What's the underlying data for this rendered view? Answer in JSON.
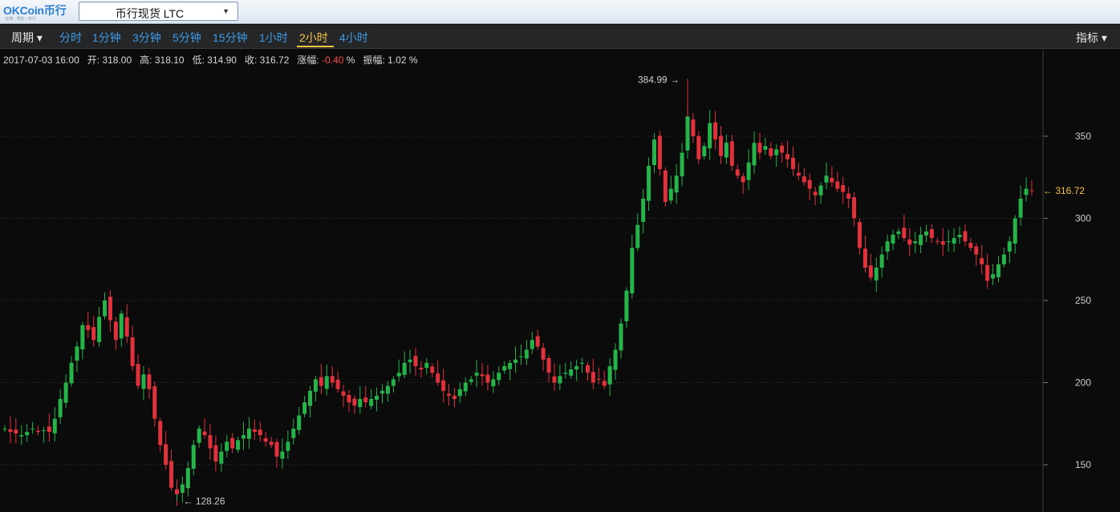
{
  "app": {
    "logo_text": "OKCoin币行",
    "logo_subtext": "全球 · 领先 · 币行"
  },
  "symbol_select": {
    "label": "币行现货 LTC",
    "caret": "▼"
  },
  "toolbar": {
    "period_menu": "周期 ▾",
    "periods": [
      "分时",
      "1分钟",
      "3分钟",
      "5分钟",
      "15分钟",
      "1小时",
      "2小时",
      "4小时"
    ],
    "active_period": "2小时",
    "indicator_menu": "指标 ▾"
  },
  "ohlc_info": {
    "datetime": "2017-07-03 16:00",
    "open_label": "开:",
    "open": "318.00",
    "high_label": "高:",
    "high": "318.10",
    "low_label": "低:",
    "low": "314.90",
    "close_label": "收:",
    "close": "316.72",
    "change_label": "涨幅:",
    "change": "-0.40",
    "change_unit": "%",
    "amplitude_label": "振幅:",
    "amplitude": "1.02 %"
  },
  "colors": {
    "up": "#25b34a",
    "down": "#e0323c",
    "accent": "#f6c343",
    "link": "#3f9be8",
    "background": "#0b0b0c"
  },
  "chart_data": {
    "type": "candlestick",
    "y_ticks": [
      150,
      200,
      250,
      300,
      350
    ],
    "ylim": [
      122,
      398
    ],
    "grid": true,
    "max_annotation": {
      "label": "384.99",
      "value": 384.99
    },
    "min_annotation": {
      "label": "128.26",
      "value": 128.26
    },
    "last_price": {
      "label": "316.72",
      "value": 316.72
    },
    "closes": [
      172,
      170,
      169,
      168,
      170,
      172,
      170,
      171,
      170,
      178,
      190,
      200,
      212,
      222,
      235,
      232,
      226,
      240,
      250,
      238,
      226,
      242,
      228,
      210,
      198,
      205,
      196,
      178,
      162,
      150,
      136,
      132,
      138,
      148,
      162,
      172,
      168,
      160,
      152,
      158,
      164,
      160,
      165,
      168,
      172,
      170,
      168,
      164,
      162,
      155,
      158,
      164,
      172,
      180,
      188,
      195,
      202,
      198,
      204,
      200,
      196,
      192,
      188,
      186,
      190,
      188,
      190,
      192,
      195,
      198,
      202,
      206,
      212,
      214,
      210,
      208,
      212,
      206,
      200,
      195,
      192,
      190,
      196,
      200,
      202,
      206,
      204,
      200,
      202,
      206,
      210,
      212,
      214,
      216,
      220,
      226,
      222,
      214,
      206,
      200,
      204,
      206,
      208,
      210,
      212,
      206,
      200,
      202,
      198,
      210,
      220,
      236,
      256,
      282,
      296,
      312,
      332,
      348,
      330,
      310,
      318,
      326,
      340,
      362,
      350,
      336,
      344,
      358,
      348,
      338,
      346,
      332,
      326,
      322,
      334,
      346,
      340,
      344,
      338,
      342,
      340,
      336,
      330,
      326,
      322,
      318,
      314,
      320,
      326,
      322,
      318,
      316,
      312,
      300,
      282,
      270,
      264,
      270,
      278,
      286,
      290,
      292,
      288,
      284,
      286,
      290,
      292,
      288,
      286,
      284,
      286,
      288,
      290,
      286,
      282,
      278,
      272,
      262,
      266,
      272,
      278,
      286,
      300,
      312,
      318,
      316.72
    ]
  }
}
